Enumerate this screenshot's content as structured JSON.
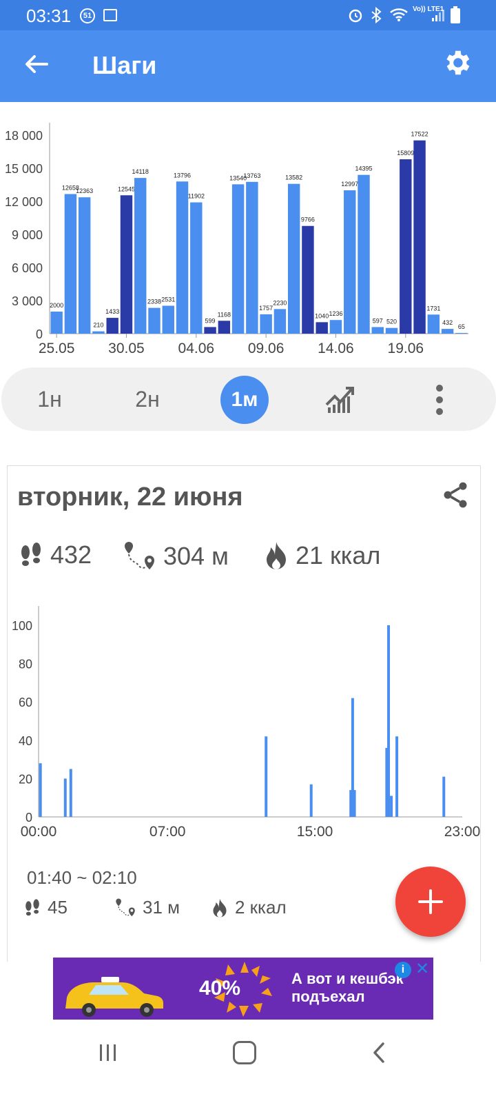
{
  "status_bar": {
    "time": "03:31",
    "badge": "51",
    "lte": "Vo)) LTE1"
  },
  "app_bar": {
    "title": "Шаги"
  },
  "month_chart": {
    "y_ticks": [
      "18 000",
      "15 000",
      "12 000",
      "9 000",
      "6 000",
      "3 000",
      "0"
    ],
    "x_ticks": [
      "25.05",
      "30.05",
      "04.06",
      "09.06",
      "14.06",
      "19.06"
    ]
  },
  "range_tabs": {
    "week": "1н",
    "two_weeks": "2н",
    "month": "1м"
  },
  "day": {
    "title": "вторник, 22 июня",
    "steps": "432",
    "distance": "304 м",
    "calories": "21 ккал",
    "y_ticks": [
      "100",
      "80",
      "60",
      "40",
      "20",
      "0"
    ],
    "x_ticks": [
      "00:00",
      "07:00",
      "15:00",
      "23:00"
    ]
  },
  "interval": {
    "time": "01:40 ~ 02:10",
    "steps": "45",
    "distance": "31 м",
    "calories": "2 ккал"
  },
  "ad": {
    "percent": "40%",
    "line1": "А вот и кешбэк",
    "line2": "подъехал"
  },
  "chart_data": [
    {
      "type": "bar",
      "categories": [
        "25.05",
        "26.05",
        "27.05",
        "28.05",
        "29.05",
        "30.05",
        "31.05",
        "01.06",
        "02.06",
        "03.06",
        "04.06",
        "05.06",
        "06.06",
        "07.06",
        "08.06",
        "09.06",
        "10.06",
        "11.06",
        "12.06",
        "13.06",
        "14.06",
        "15.06",
        "16.06",
        "17.06",
        "18.06",
        "19.06",
        "20.06",
        "21.06",
        "22.06",
        "23.06"
      ],
      "values": [
        2000,
        12658,
        12363,
        210,
        1433,
        12545,
        14118,
        2338,
        2531,
        13796,
        11902,
        599,
        1168,
        13540,
        13763,
        1757,
        2230,
        13582,
        9766,
        1040,
        1236,
        12997,
        14395,
        597,
        520,
        15809,
        17522,
        1731,
        432,
        65
      ],
      "highlight": [
        4,
        5,
        11,
        12,
        18,
        19,
        25,
        26
      ],
      "colors": {
        "bar": "#4a8ef0",
        "highlight": "#2a3aa6"
      },
      "ylim": [
        0,
        18000
      ],
      "xlabel": "",
      "ylabel": "",
      "title": ""
    },
    {
      "type": "bar",
      "x_hours": [
        0.1,
        1.45,
        1.75,
        12.35,
        14.8,
        16.95,
        17.05,
        17.15,
        18.9,
        19.0,
        19.15,
        19.45,
        22.0
      ],
      "values": [
        28,
        20,
        25,
        42,
        17,
        14,
        62,
        14,
        36,
        100,
        11,
        42,
        21
      ],
      "xlim": [
        0,
        23
      ],
      "ylim": [
        0,
        100
      ],
      "colors": {
        "bar": "#4a8ef0"
      },
      "xlabel": "",
      "ylabel": "",
      "title": ""
    }
  ]
}
